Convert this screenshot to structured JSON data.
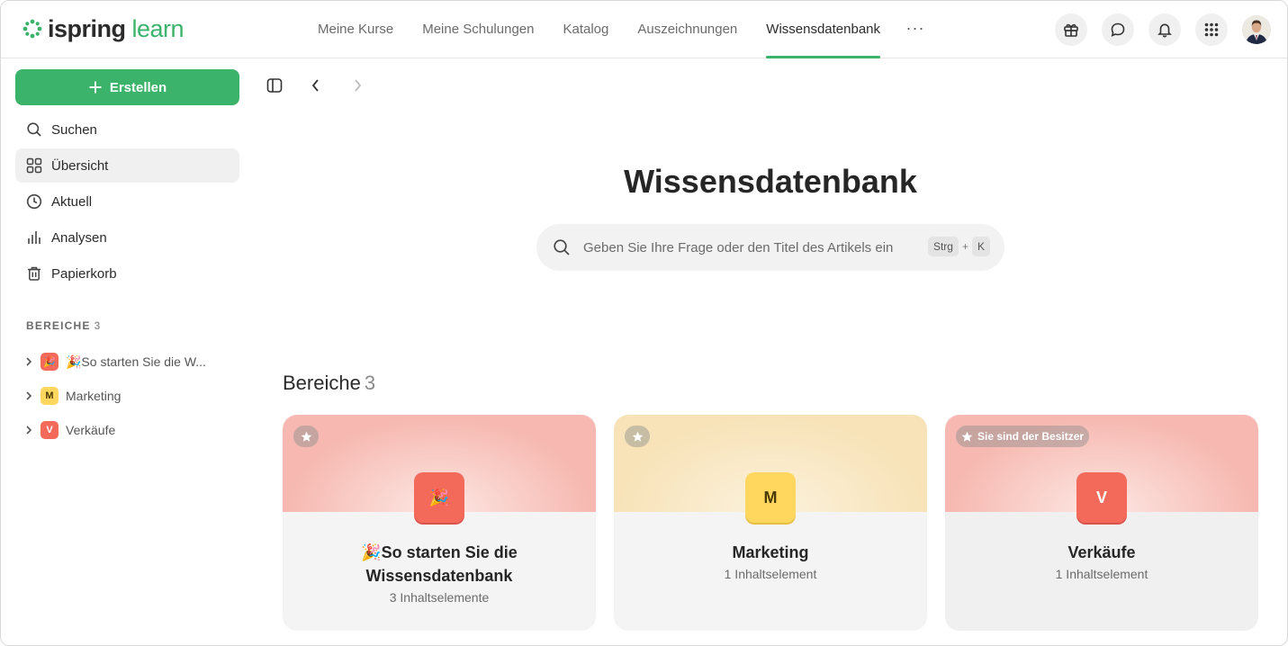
{
  "app": {
    "logo_primary": "ispring",
    "logo_secondary": "learn",
    "accent": "#3bb36a"
  },
  "nav": {
    "items": [
      {
        "label": "Meine Kurse",
        "active": false
      },
      {
        "label": "Meine Schulungen",
        "active": false
      },
      {
        "label": "Katalog",
        "active": false
      },
      {
        "label": "Auszeichnungen",
        "active": false
      },
      {
        "label": "Wissensdatenbank",
        "active": true
      }
    ],
    "more_label": "···",
    "icons": [
      "gift-icon",
      "chat-icon",
      "bell-icon",
      "apps-grid-icon"
    ]
  },
  "sidebar": {
    "create_label": "Erstellen",
    "menu": [
      {
        "label": "Suchen",
        "icon": "search-icon",
        "active": false
      },
      {
        "label": "Übersicht",
        "icon": "grid-icon",
        "active": true
      },
      {
        "label": "Aktuell",
        "icon": "clock-icon",
        "active": false
      },
      {
        "label": "Analysen",
        "icon": "bar-chart-icon",
        "active": false
      },
      {
        "label": "Papierkorb",
        "icon": "trash-icon",
        "active": false
      }
    ],
    "section_title": "BEREICHE",
    "section_count": "3",
    "areas": [
      {
        "label": "🎉So starten Sie die W...",
        "badge": "🎉",
        "color": "#f46a5a"
      },
      {
        "label": "Marketing",
        "badge": "M",
        "color": "#ffd75e"
      },
      {
        "label": "Verkäufe",
        "badge": "V",
        "color": "#f46a5a"
      }
    ]
  },
  "main": {
    "title": "Wissensdatenbank",
    "search_placeholder": "Geben Sie Ihre Frage oder den Titel des Artikels ein",
    "shortcut_key1": "Strg",
    "shortcut_plus": "+",
    "shortcut_key2": "K",
    "areas_heading": "Bereiche",
    "areas_count": "3",
    "cards": [
      {
        "title": "🎉So starten Sie die Wissensdatenbank",
        "subtitle": "3 Inhaltselemente",
        "icon": "🎉",
        "owner_label": "",
        "head_color": "#f6b8b0",
        "icon_bg": "#f46a5a"
      },
      {
        "title": "Marketing",
        "subtitle": "1 Inhaltselement",
        "icon": "M",
        "owner_label": "",
        "head_color": "#f8e3b8",
        "icon_bg": "#ffd75e"
      },
      {
        "title": "Verkäufe",
        "subtitle": "1 Inhaltselement",
        "icon": "V",
        "owner_label": "Sie sind der Besitzer",
        "head_color": "#f6b8b0",
        "icon_bg": "#f46a5a"
      }
    ]
  }
}
